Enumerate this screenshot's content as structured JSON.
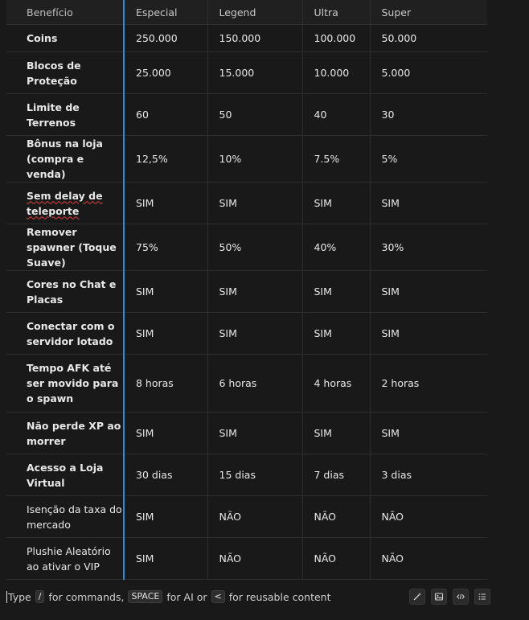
{
  "table": {
    "headers": [
      "Benefício",
      "Especial",
      "Legend",
      "Ultra",
      "Super"
    ],
    "rows": [
      [
        "Coins",
        "250.000",
        "150.000",
        "100.000",
        "50.000"
      ],
      [
        "Blocos de Proteção",
        "25.000",
        "15.000",
        "10.000",
        "5.000"
      ],
      [
        "Limite de Terrenos",
        "60",
        "50",
        "40",
        "30"
      ],
      [
        "Bônus na loja (compra e venda)",
        "12,5%",
        "10%",
        "7.5%",
        "5%"
      ],
      [
        "Sem delay de teleporte",
        "SIM",
        "SIM",
        "SIM",
        "SIM"
      ],
      [
        "Remover spawner (Toque Suave)",
        "75%",
        "50%",
        "40%",
        "30%"
      ],
      [
        "Cores no Chat e Placas",
        "SIM",
        "SIM",
        "SIM",
        "SIM"
      ],
      [
        "Conectar com o servidor lotado",
        "SIM",
        "SIM",
        "SIM",
        "SIM"
      ],
      [
        "Tempo AFK até ser movido para o spawn",
        "8 horas",
        "6 horas",
        "4 horas",
        "2 horas"
      ],
      [
        "Não perde XP ao morrer",
        "SIM",
        "SIM",
        "SIM",
        "SIM"
      ],
      [
        "Acesso a Loja Virtual",
        "30 dias",
        "15 dias",
        "7 dias",
        "3 dias"
      ],
      [
        "Isenção da taxa do mercado",
        "SIM",
        "NÃO",
        "NÃO",
        "NÃO"
      ],
      [
        "Plushie Aleatório ao ativar o VIP",
        "SIM",
        "NÃO",
        "NÃO",
        "NÃO"
      ]
    ]
  },
  "footer": {
    "hint_type": "Type",
    "key_slash": "/",
    "hint_commands": "for commands,",
    "key_space": "SPACE",
    "hint_ai": "for AI or",
    "key_lt": "<",
    "hint_reusable": "for reusable content"
  },
  "icons": [
    "magic-wand-icon",
    "image-icon",
    "code-icon",
    "list-icon"
  ],
  "colors": {
    "background": "#191919",
    "accent_border": "#2e8ccf",
    "spell_underline": "#e04040"
  }
}
